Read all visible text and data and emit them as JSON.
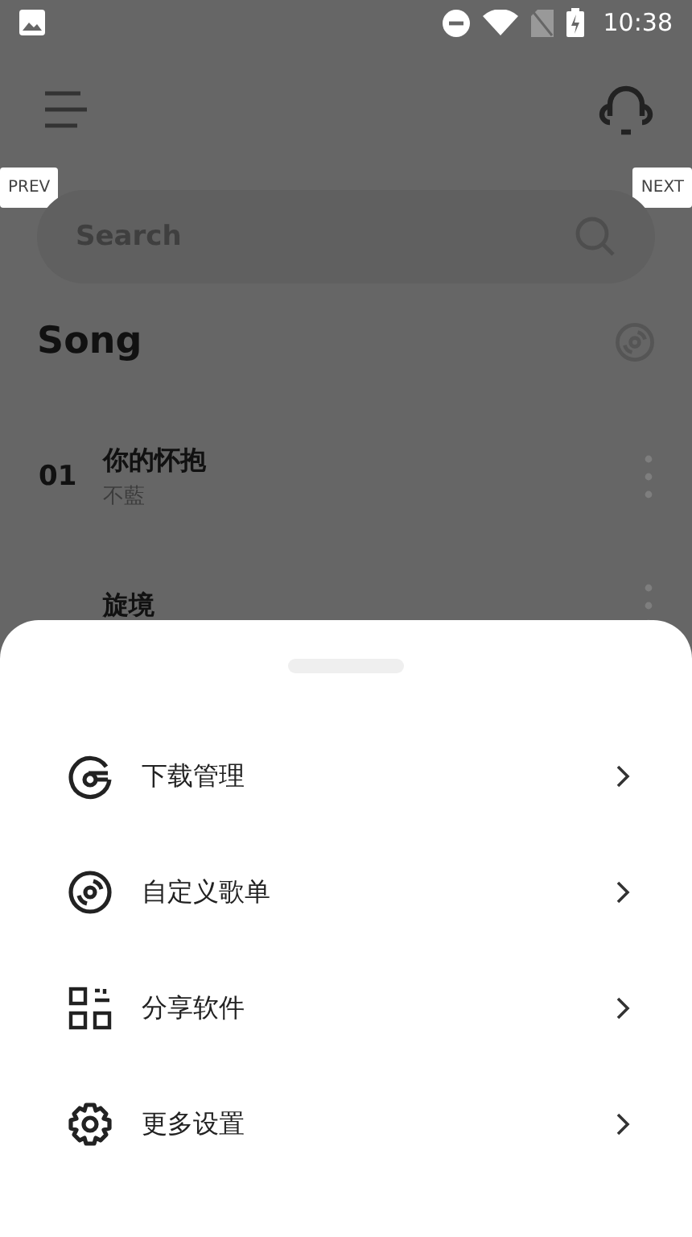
{
  "status_bar": {
    "time": "10:38"
  },
  "gallery_nav": {
    "prev": "PREV",
    "next": "NEXT"
  },
  "search": {
    "placeholder": "Search"
  },
  "section_title": "Song",
  "songs": [
    {
      "number": "01",
      "title": "你的怀抱",
      "artist": "不藍"
    },
    {
      "title": "旋境"
    }
  ],
  "sheet": {
    "items": [
      {
        "kind": "download",
        "label": "下载管理"
      },
      {
        "kind": "playlist",
        "label": "自定义歌单"
      },
      {
        "kind": "share",
        "label": "分享软件"
      },
      {
        "kind": "settings",
        "label": "更多设置"
      }
    ]
  }
}
